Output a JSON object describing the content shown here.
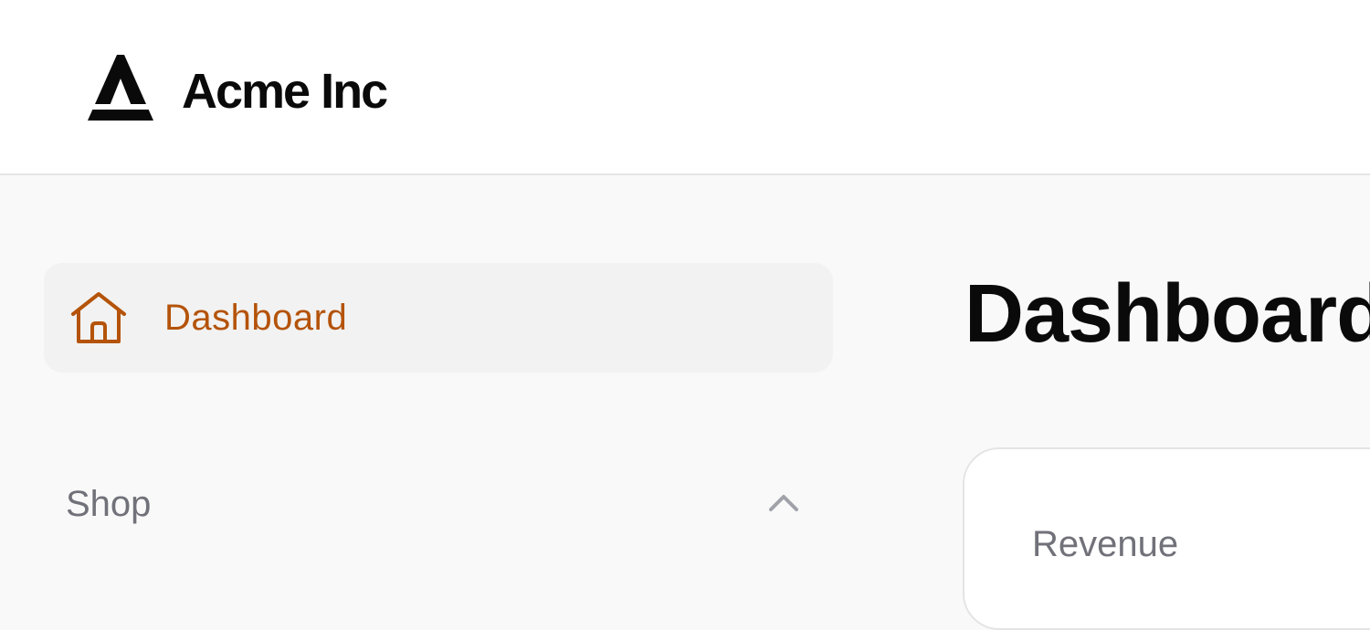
{
  "header": {
    "brand_name": "Acme Inc",
    "logo_icon": "acme-logo-icon"
  },
  "sidebar": {
    "items": [
      {
        "label": "Dashboard",
        "icon": "home-icon",
        "active": true,
        "color": "#b45309"
      }
    ],
    "sections": [
      {
        "label": "Shop",
        "expanded": true,
        "icon": "chevron-up-icon"
      }
    ]
  },
  "main": {
    "title": "Dashboard",
    "cards": [
      {
        "label": "Revenue"
      }
    ]
  },
  "colors": {
    "accent": "#b45309",
    "text_primary": "#0a0a0a",
    "text_muted": "#71717a",
    "active_bg": "#f2f2f2"
  }
}
